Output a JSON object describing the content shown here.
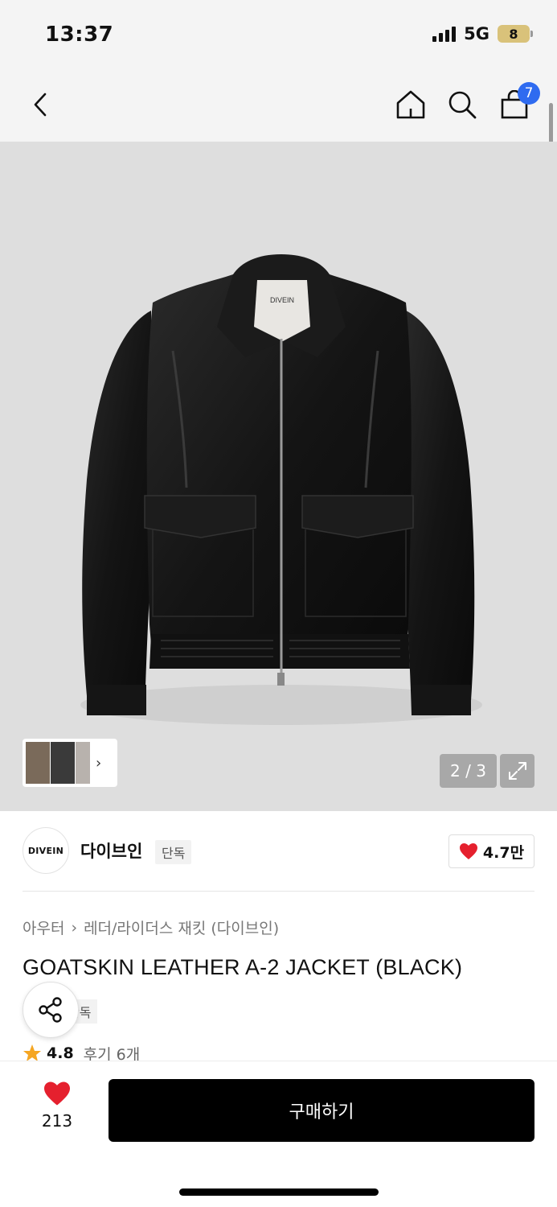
{
  "status_bar": {
    "time": "13:37",
    "network": "5G",
    "battery": "8"
  },
  "nav": {
    "icons": [
      "back-icon",
      "home-icon",
      "search-icon",
      "cart-icon"
    ],
    "cart_count": "7"
  },
  "gallery": {
    "counter": "2 / 3",
    "jacket_label": "DIVEIN",
    "thumbnail_icons": [
      "thumbnail-1",
      "thumbnail-2",
      "thumbnail-3"
    ]
  },
  "brand": {
    "logo_text": "DIVEIN",
    "name": "다이브인",
    "tag": "단독",
    "like_count": "4.7만"
  },
  "product": {
    "breadcrumb": [
      "아우터",
      "레더/라이더스 재킷 (다이브인)"
    ],
    "title": "GOATSKIN LEATHER A-2 JACKET (BLACK)",
    "exclusive_tag": "단독",
    "rating": "4.8",
    "reviews": "후기 6개"
  },
  "bottom_bar": {
    "wish_count": "213",
    "buy_label": "구매하기"
  },
  "colors": {
    "accent_blue": "#2f6bf0",
    "heart_red": "#e5202e",
    "star_orange": "#f5a623",
    "buy_button": "#000000"
  }
}
